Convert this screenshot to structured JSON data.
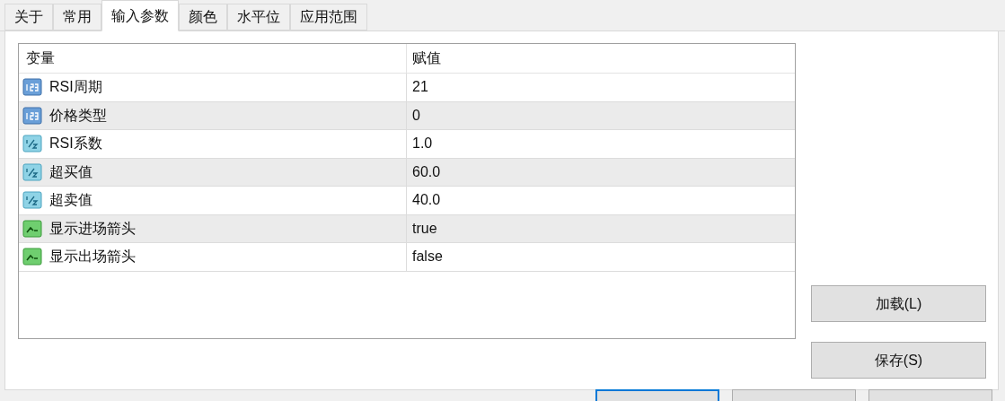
{
  "tabs": [
    {
      "label": "关于",
      "selected": false
    },
    {
      "label": "常用",
      "selected": false
    },
    {
      "label": "输入参数",
      "selected": true
    },
    {
      "label": "颜色",
      "selected": false
    },
    {
      "label": "水平位",
      "selected": false
    },
    {
      "label": "应用范围",
      "selected": false
    }
  ],
  "table": {
    "columns": [
      "变量",
      "赋值"
    ],
    "rows": [
      {
        "kind": "integer",
        "name": "RSI周期",
        "value": "21"
      },
      {
        "kind": "integer",
        "name": "价格类型",
        "value": "0"
      },
      {
        "kind": "double",
        "name": "RSI系数",
        "value": "1.0"
      },
      {
        "kind": "double",
        "name": "超买值",
        "value": "60.0"
      },
      {
        "kind": "double",
        "name": "超卖值",
        "value": "40.0"
      },
      {
        "kind": "bool",
        "name": "显示进场箭头",
        "value": "true"
      },
      {
        "kind": "bool",
        "name": "显示出场箭头",
        "value": "false"
      }
    ]
  },
  "buttons": [
    "加载(L)",
    "保存(S)"
  ],
  "footer_buttons": [
    {
      "default": true
    },
    {
      "default": false
    },
    {
      "default": false
    }
  ]
}
